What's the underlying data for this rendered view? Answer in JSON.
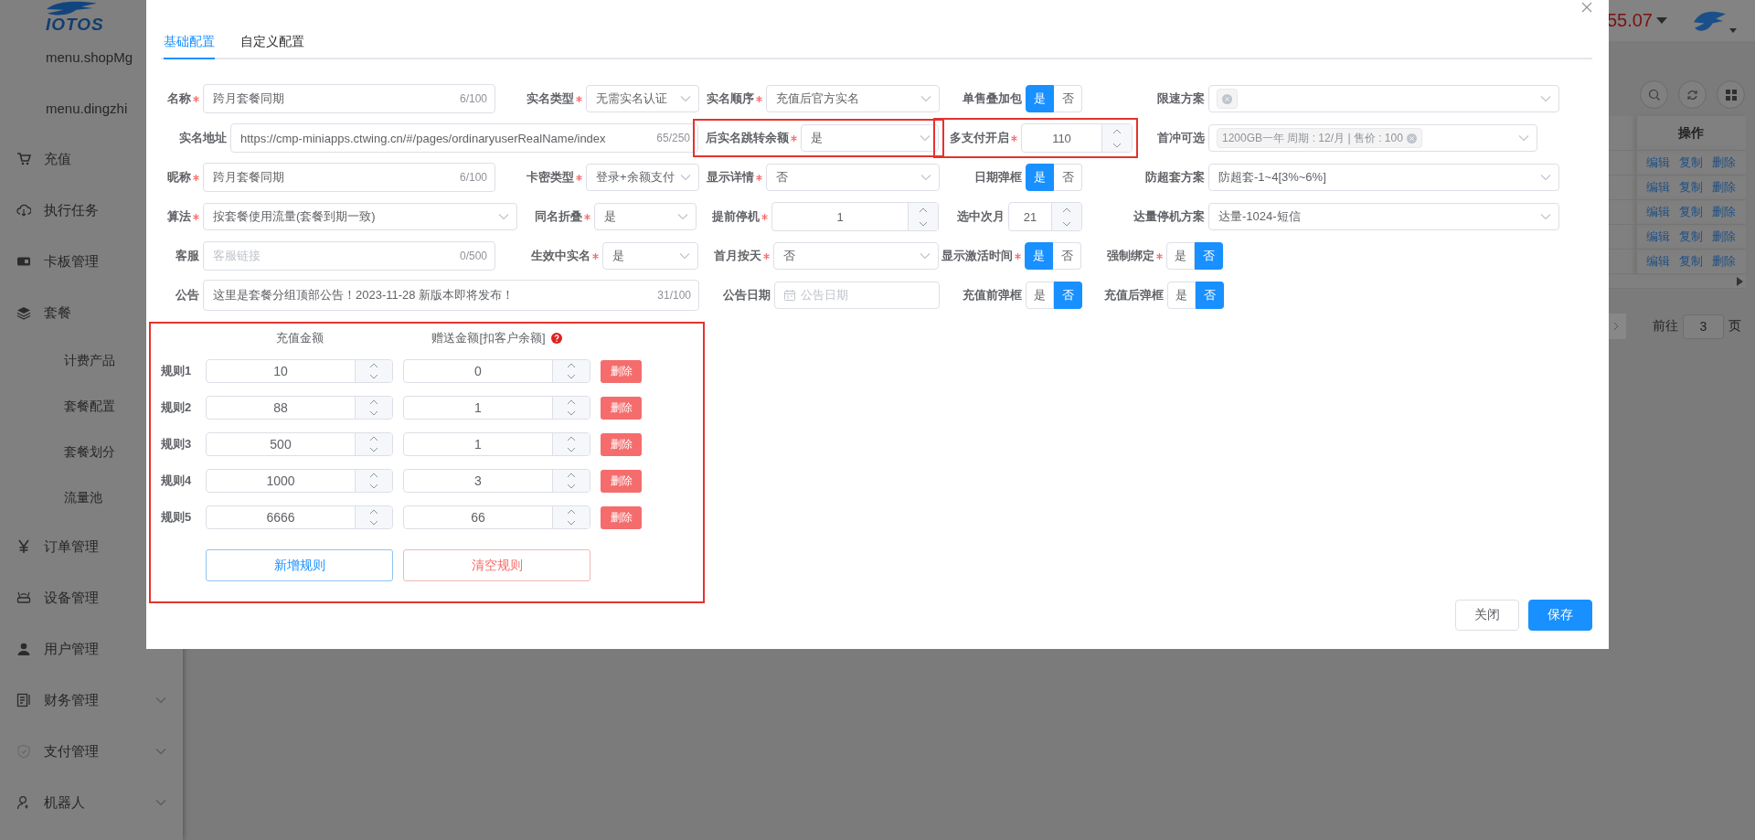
{
  "sidebar": {
    "logo": "IOTOS",
    "items": [
      {
        "label": "menu.shopMg"
      },
      {
        "label": "menu.dingzhi"
      },
      {
        "label": "充值"
      },
      {
        "label": "执行任务"
      },
      {
        "label": "卡板管理"
      },
      {
        "label": "套餐",
        "children": [
          {
            "label": "计费产品"
          },
          {
            "label": "套餐配置"
          },
          {
            "label": "套餐划分"
          },
          {
            "label": "流量池"
          }
        ]
      },
      {
        "label": "订单管理"
      },
      {
        "label": "设备管理"
      },
      {
        "label": "用户管理"
      },
      {
        "label": "财务管理",
        "expanded": false
      },
      {
        "label": "支付管理",
        "expanded": false
      },
      {
        "label": "机器人",
        "expanded": false
      }
    ]
  },
  "header": {
    "balance": "55.07"
  },
  "table": {
    "columns": [
      "操作"
    ],
    "rows": [
      {
        "actions": [
          "编辑",
          "复制",
          "删除"
        ]
      },
      {
        "actions": [
          "编辑",
          "复制",
          "删除"
        ]
      },
      {
        "actions": [
          "编辑",
          "复制",
          "删除"
        ]
      },
      {
        "actions": [
          "编辑",
          "复制",
          "删除"
        ]
      },
      {
        "actions": [
          "编辑",
          "复制",
          "删除"
        ]
      }
    ]
  },
  "pagination": {
    "goto_label": "前往",
    "page": "3",
    "page_suffix": "页"
  },
  "dialog": {
    "tabs": [
      {
        "label": "基础配置",
        "selected": true
      },
      {
        "label": "自定义配置",
        "selected": false
      }
    ],
    "form": {
      "rows": [
        [
          {
            "label": "名称",
            "required": true,
            "highlighted": false,
            "kind": "text",
            "value": "跨月套餐同期",
            "counter": "6/100"
          },
          {
            "label": "实名类型",
            "required": true,
            "highlighted": false,
            "kind": "select",
            "value": "无需实名认证"
          },
          {
            "label": "实名顺序",
            "required": true,
            "highlighted": false,
            "kind": "select",
            "value": "充值后官方实名"
          },
          {
            "label": "单售叠加包",
            "required": false,
            "highlighted": false,
            "kind": "toggle",
            "options": [
              {
                "label": "是",
                "selected": true
              },
              {
                "label": "否",
                "selected": false
              }
            ]
          },
          {
            "label": "限速方案",
            "required": false,
            "highlighted": false,
            "kind": "tags",
            "tags": [
              {
                "kind": "blank"
              }
            ]
          }
        ],
        [
          {
            "label": "实名地址",
            "required": false,
            "highlighted": false,
            "kind": "text",
            "value": "https://cmp-miniapps.ctwing.cn/#/pages/ordinaryuserRealName/index",
            "counter": "65/250"
          },
          {
            "label": "后实名跳转余额",
            "required": true,
            "highlighted": true,
            "kind": "select",
            "value": "是"
          },
          {
            "label": "多支付开启",
            "required": true,
            "highlighted": true,
            "kind": "number",
            "value": "110"
          },
          {
            "label": "首冲可选",
            "required": false,
            "highlighted": false,
            "kind": "tags",
            "tags": [
              {
                "kind": "text",
                "text": "1200GB一年 周期 : 12/月 | 售价 : 100"
              }
            ]
          }
        ],
        [
          {
            "label": "昵称",
            "required": true,
            "highlighted": false,
            "kind": "text",
            "value": "跨月套餐同期",
            "counter": "6/100"
          },
          {
            "label": "卡密类型",
            "required": true,
            "highlighted": false,
            "kind": "select",
            "value": "登录+余额支付"
          },
          {
            "label": "显示详情",
            "required": true,
            "highlighted": false,
            "kind": "select",
            "value": "否"
          },
          {
            "label": "日期弹框",
            "required": false,
            "highlighted": false,
            "kind": "toggle",
            "options": [
              {
                "label": "是",
                "selected": true
              },
              {
                "label": "否",
                "selected": false
              }
            ]
          },
          {
            "label": "防超套方案",
            "required": false,
            "highlighted": false,
            "kind": "select",
            "value": "防超套-1~4[3%~6%]"
          }
        ],
        [
          {
            "label": "算法",
            "required": true,
            "highlighted": false,
            "kind": "select",
            "value": "按套餐使用流量(套餐到期一致)"
          },
          {
            "label": "同名折叠",
            "required": true,
            "highlighted": false,
            "kind": "select",
            "value": "是"
          },
          {
            "label": "提前停机",
            "required": true,
            "highlighted": false,
            "kind": "number",
            "value": "1"
          },
          {
            "label": "选中次月",
            "required": false,
            "highlighted": false,
            "kind": "number",
            "value": "21"
          },
          {
            "label": "达量停机方案",
            "required": false,
            "highlighted": false,
            "kind": "select",
            "value": "达量-1024-短信"
          }
        ],
        [
          {
            "label": "客服",
            "required": false,
            "highlighted": false,
            "kind": "text",
            "placeholder": "客服链接",
            "counter": "0/500"
          },
          {
            "label": "生效中实名",
            "required": true,
            "highlighted": false,
            "kind": "select",
            "value": "是"
          },
          {
            "label": "首月按天",
            "required": true,
            "highlighted": false,
            "kind": "select",
            "value": "否"
          },
          {
            "label": "显示激活时间",
            "required": true,
            "highlighted": false,
            "kind": "toggle",
            "options": [
              {
                "label": "是",
                "selected": true
              },
              {
                "label": "否",
                "selected": false
              }
            ]
          },
          {
            "label": "强制绑定",
            "required": true,
            "highlighted": false,
            "kind": "toggle",
            "options": [
              {
                "label": "是",
                "selected": false
              },
              {
                "label": "否",
                "selected": true
              }
            ]
          }
        ],
        [
          {
            "label": "公告",
            "required": false,
            "highlighted": false,
            "kind": "textarea",
            "value": "这里是套餐分组顶部公告！2023-11-28 新版本即将发布！",
            "counter": "31/100"
          },
          {
            "label": "公告日期",
            "required": false,
            "highlighted": false,
            "kind": "date",
            "placeholder": "公告日期"
          },
          {
            "label": "充值前弹框",
            "required": false,
            "highlighted": false,
            "kind": "toggle",
            "options": [
              {
                "label": "是",
                "selected": false
              },
              {
                "label": "否",
                "selected": true
              }
            ]
          },
          {
            "label": "充值后弹框",
            "required": false,
            "highlighted": false,
            "kind": "toggle",
            "options": [
              {
                "label": "是",
                "selected": false
              },
              {
                "label": "否",
                "selected": true
              }
            ]
          }
        ]
      ]
    },
    "rules": {
      "highlighted": true,
      "columns": [
        {
          "label": "充值金额",
          "help": false
        },
        {
          "label": "赠送金额[扣客户余额]",
          "help": true
        }
      ],
      "items": [
        {
          "label": "规则1",
          "amount": "10",
          "gift": "0",
          "delete": "删除"
        },
        {
          "label": "规则2",
          "amount": "88",
          "gift": "1",
          "delete": "删除"
        },
        {
          "label": "规则3",
          "amount": "500",
          "gift": "1",
          "delete": "删除"
        },
        {
          "label": "规则4",
          "amount": "1000",
          "gift": "3",
          "delete": "删除"
        },
        {
          "label": "规则5",
          "amount": "6666",
          "gift": "66",
          "delete": "删除"
        }
      ],
      "actions": [
        {
          "label": "新增规则",
          "kind": "add"
        },
        {
          "label": "清空规则",
          "kind": "clear"
        }
      ]
    },
    "footer": [
      {
        "label": "关闭",
        "kind": "default"
      },
      {
        "label": "保存",
        "kind": "primary"
      }
    ]
  }
}
